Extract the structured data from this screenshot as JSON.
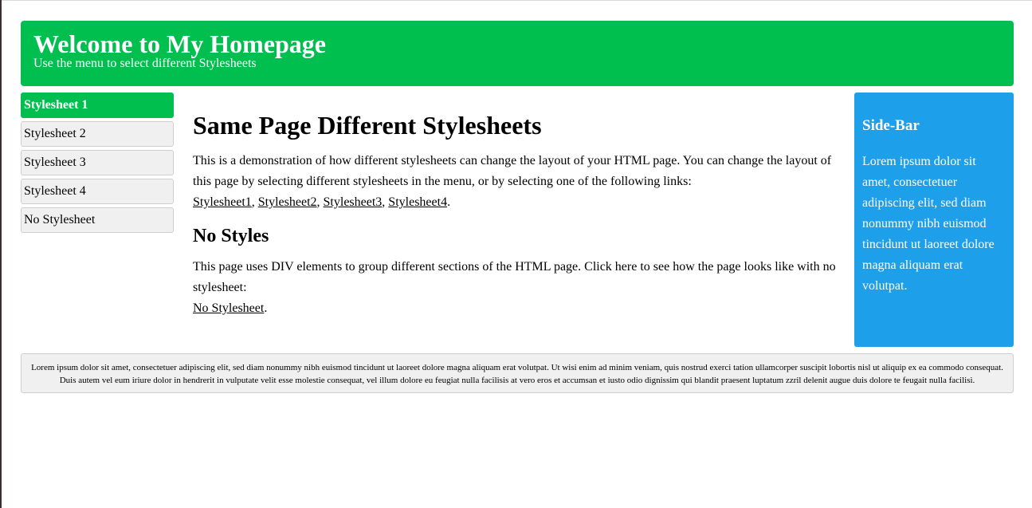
{
  "header": {
    "title": "Welcome to My Homepage",
    "subtitle": "Use the menu to select different Stylesheets"
  },
  "menu": {
    "items": [
      {
        "label": "Stylesheet 1",
        "active": true
      },
      {
        "label": "Stylesheet 2",
        "active": false
      },
      {
        "label": "Stylesheet 3",
        "active": false
      },
      {
        "label": "Stylesheet 4",
        "active": false
      },
      {
        "label": "No Stylesheet",
        "active": false
      }
    ]
  },
  "main": {
    "heading": "Same Page Different Stylesheets",
    "intro": "This is a demonstration of how different stylesheets can change the layout of your HTML page. You can change the layout of this page by selecting different stylesheets in the menu, or by selecting one of the following links:",
    "links": [
      "Stylesheet1",
      "Stylesheet2",
      "Stylesheet3",
      "Stylesheet4"
    ],
    "link_separator": ", ",
    "link_end": ".",
    "subheading": "No Styles",
    "nostyle_text": "This page uses DIV elements to group different sections of the HTML page. Click here to see how the page looks like with no stylesheet:",
    "nostyle_link": "No Stylesheet",
    "nostyle_end": "."
  },
  "sidebar": {
    "title": "Side-Bar",
    "text": "Lorem ipsum dolor sit amet, consectetuer adipiscing elit, sed diam nonummy nibh euismod tincidunt ut laoreet dolore magna aliquam erat volutpat."
  },
  "footer": {
    "text": "Lorem ipsum dolor sit amet, consectetuer adipiscing elit, sed diam nonummy nibh euismod tincidunt ut laoreet dolore magna aliquam erat volutpat. Ut wisi enim ad minim veniam, quis nostrud exerci tation ullamcorper suscipit lobortis nisl ut aliquip ex ea commodo consequat. Duis autem vel eum iriure dolor in hendrerit in vulputate velit esse molestie consequat, vel illum dolore eu feugiat nulla facilisis at vero eros et accumsan et iusto odio dignissim qui blandit praesent luptatum zzril delenit augue duis dolore te feugait nulla facilisi."
  },
  "colors": {
    "header_bg": "#00bf4f",
    "active_menu_bg": "#00bf4f",
    "sidebar_bg": "#1e9fea",
    "menu_bg": "#f0f0f0"
  }
}
